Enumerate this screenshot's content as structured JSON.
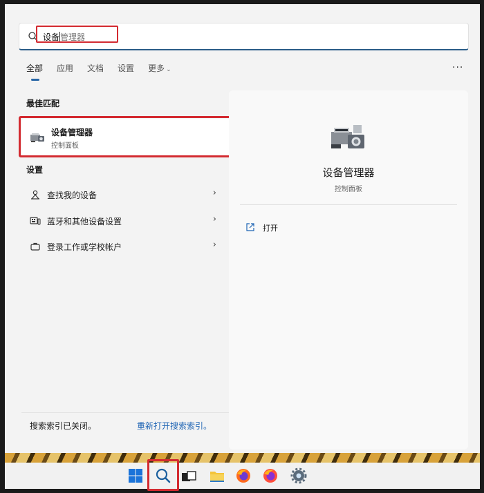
{
  "search": {
    "typed": "设备",
    "suggestion": "管理器"
  },
  "tabs": [
    "全部",
    "应用",
    "文档",
    "设置",
    "更多"
  ],
  "more_menu_glyph": "···",
  "left": {
    "best_match_heading": "最佳匹配",
    "best_match": {
      "title": "设备管理器",
      "subtitle": "控制面板",
      "icon": "device-manager-icon"
    },
    "settings_heading": "设置",
    "settings_items": [
      {
        "label": "查找我的设备",
        "icon": "person-location-icon"
      },
      {
        "label": "蓝牙和其他设备设置",
        "icon": "keyboard-device-icon"
      },
      {
        "label": "登录工作或学校帐户",
        "icon": "briefcase-icon"
      }
    ],
    "index_note": "搜索索引已关闭。",
    "index_link": "重新打开搜索索引。"
  },
  "right": {
    "title": "设备管理器",
    "subtitle": "控制面板",
    "open_label": "打开"
  },
  "taskbar": {
    "icons": [
      "windows-start-icon",
      "search-icon",
      "task-view-icon",
      "file-explorer-icon",
      "firefox-icon",
      "firefox-icon",
      "settings-gear-icon"
    ]
  },
  "colors": {
    "accent": "#2766a6",
    "highlight_red": "#d32a30",
    "link": "#1e64b4"
  }
}
